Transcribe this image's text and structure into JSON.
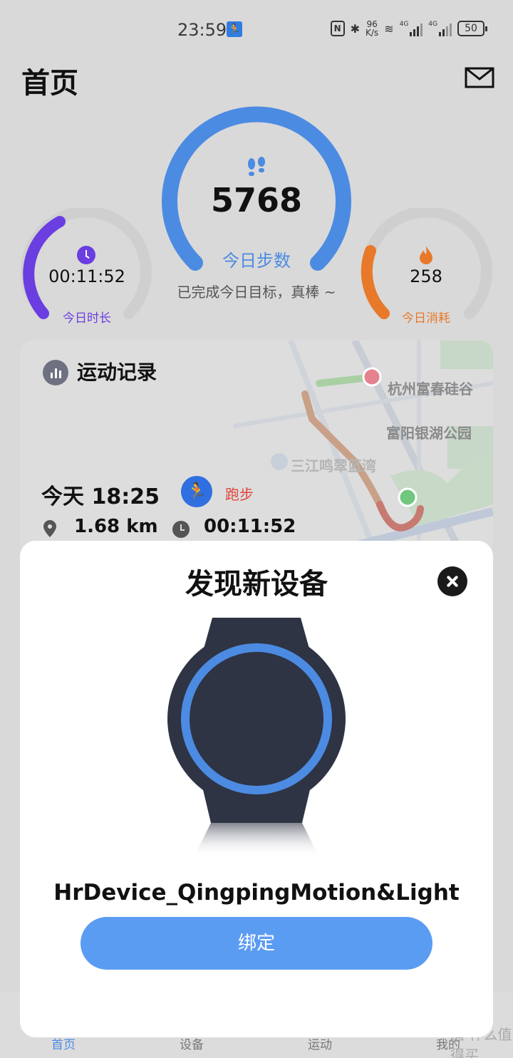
{
  "status_bar": {
    "time": "23:59",
    "network_speed_value": "96",
    "network_speed_unit": "K/s",
    "signal_1": "4G",
    "signal_2": "4G",
    "battery": "50"
  },
  "header": {
    "title": "首页"
  },
  "summary": {
    "steps": {
      "value": "5768",
      "label": "今日步数",
      "progress": 1.0,
      "color": "#4c8be2"
    },
    "goal_text": "已完成今日目标，真棒 ~",
    "duration": {
      "value": "00:11:52",
      "label": "今日时长",
      "color": "#6a3ee0"
    },
    "calories": {
      "value": "258",
      "label": "今日消耗",
      "color": "#e8792a"
    }
  },
  "record_card": {
    "title": "运动记录",
    "map_labels": [
      "杭州富春硅谷",
      "富阳银湖公园",
      "三江鸣翠蓝湾"
    ],
    "date": "今天 18:25",
    "type": "跑步",
    "distance": "1.68 km",
    "duration": "00:11:52"
  },
  "bottom_nav": {
    "items": [
      {
        "label": "首页",
        "active": true
      },
      {
        "label": "设备",
        "active": false
      },
      {
        "label": "运动",
        "active": false
      },
      {
        "label": "我的",
        "active": false
      }
    ]
  },
  "dialog": {
    "title": "发现新设备",
    "device_name": "HrDevice_QingpingMotion&Light",
    "bind_label": "绑定"
  },
  "watermark": "值 什么值得买"
}
